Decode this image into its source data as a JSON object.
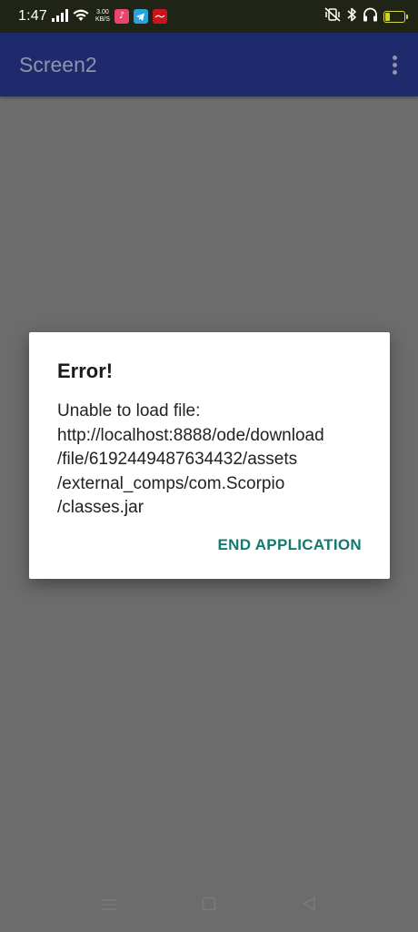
{
  "status_bar": {
    "time": "1:47",
    "speed_value": "3.00",
    "speed_unit": "KB/S",
    "battery_level": "27",
    "battery_fraction": 0.27
  },
  "app_bar": {
    "title": "Screen2"
  },
  "dialog": {
    "title": "Error!",
    "message": "Unable to load file:\nhttp://localhost:8888/ode/download\n/file/6192449487634432/assets\n/external_comps/com.Scorpio\n/classes.jar",
    "action_label": "END APPLICATION"
  },
  "colors": {
    "status_bar_bg": "#1f2416",
    "app_bar_bg": "#1e2a6b",
    "scrim": "#6c6c6c",
    "accent": "#137a6d"
  },
  "icons": {
    "signal": "signal-icon",
    "wifi": "wifi-icon",
    "vibrate": "vibrate-icon",
    "bluetooth": "bluetooth-icon",
    "headphones": "headphones-icon",
    "menu": "menu-icon",
    "home": "home-icon",
    "back": "back-icon"
  }
}
